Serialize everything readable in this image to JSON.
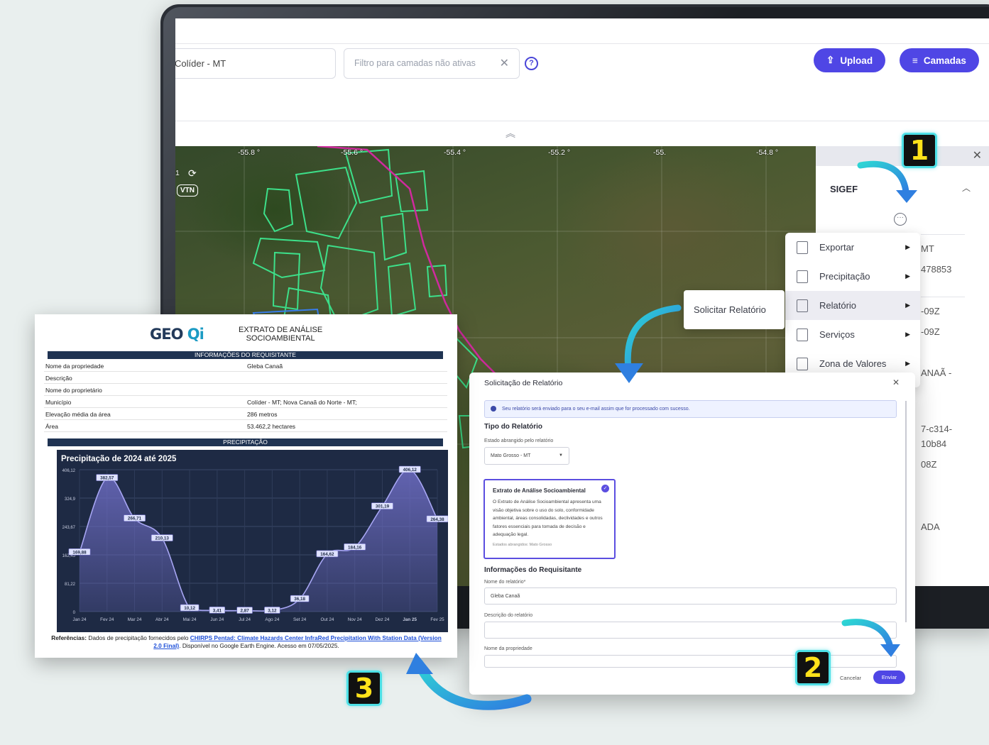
{
  "toolbar": {
    "search_value": "Colíder - MT",
    "filter_placeholder": "Filtro para camadas não ativas",
    "upload_label": "Upload",
    "layers_label": "Camadas"
  },
  "map": {
    "coords": [
      "-55.8 °",
      "-55.6 °",
      "-55.4 °",
      "-55.2 °",
      "-55.",
      "-54.8 °"
    ],
    "vtn_label": "VTN",
    "layer_index": "1"
  },
  "side_panel": {
    "section_title": "SIGEF",
    "values": [
      "MT",
      "478853",
      "-09Z",
      "-09Z",
      "ANAÃ -",
      "7-c314-",
      "10b84",
      "08Z",
      "ADA"
    ]
  },
  "context_menu": {
    "items": [
      {
        "label": "Exportar",
        "icon": "export-icon"
      },
      {
        "label": "Precipitação",
        "icon": "chart-icon"
      },
      {
        "label": "Relatório",
        "icon": "document-icon"
      },
      {
        "label": "Serviços",
        "icon": "document-icon"
      },
      {
        "label": "Zona de Valores",
        "icon": "table-icon"
      }
    ],
    "submenu_label": "Solicitar Relatório"
  },
  "modal": {
    "title": "Solicitação de Relatório",
    "info_text": "Seu relatório será enviado para o seu e-mail assim que for processado com sucesso.",
    "section_type": "Tipo do Relatório",
    "state_label": "Estado abrangido pelo relatório",
    "state_value": "Mato Grosso - MT",
    "card_title": "Extrato de Análise Socioambiental",
    "card_desc": "O Extrato de Análise Socioambiental apresenta uma visão objetiva sobre o uso do solo, conformidade ambiental, áreas consolidadas, declividades e outros fatores essenciais para tomada de decisão e adequação legal.",
    "card_states": "Estados abrangidos: Mato Grosso",
    "section_requester": "Informações do Requisitante",
    "name_label": "Nome do relatório*",
    "name_value": "Gleba Canaã",
    "desc_label": "Descrição do relatório",
    "property_label": "Nome da propriedade",
    "cancel_label": "Cancelar",
    "send_label": "Enviar"
  },
  "report": {
    "logo_left": "GEO",
    "logo_right": "Qi",
    "title_line1": "EXTRATO DE ANÁLISE",
    "title_line2": "SOCIOAMBIENTAL",
    "band_requester": "INFORMAÇÕES DO REQUISITANTE",
    "rows": [
      {
        "key": "Nome da propriedade",
        "value": "Gleba Canaã"
      },
      {
        "key": "Descrição",
        "value": ""
      },
      {
        "key": "Nome do proprietário",
        "value": ""
      },
      {
        "key": "Município",
        "value": "Colíder - MT; Nova Canaã do Norte - MT;"
      },
      {
        "key": "Elevação média da área",
        "value": "286 metros"
      },
      {
        "key": "Área",
        "value": "53.462,2 hectares"
      }
    ],
    "band_precip": "PRECIPITAÇÃO",
    "refs_label": "Referências:",
    "refs_text1": "Dados de precipitação fornecidos pelo",
    "refs_link": "CHIRPS Pentad: Climate Hazards Center InfraRed Precipitation With Station Data (Version 2.0 Final)",
    "refs_text2": ". Disponível no Google Earth Engine. Acesso em 07/05/2025."
  },
  "chart_data": {
    "type": "area",
    "title": "Precipitação de 2024 até 2025",
    "categories": [
      "Jan 24",
      "Fev 24",
      "Mar 24",
      "Abr 24",
      "Mai 24",
      "Jun 24",
      "Jul 24",
      "Ago 24",
      "Set 24",
      "Out 24",
      "Nov 24",
      "Dez 24",
      "Jan 25",
      "Fev 25"
    ],
    "values": [
      169.88,
      382.57,
      266.71,
      210.13,
      10.12,
      3.41,
      2.87,
      3.12,
      36.18,
      164.62,
      184.16,
      301.19,
      406.12,
      264.38
    ],
    "value_labels": [
      "169,88",
      "382,57",
      "266,71",
      "210,13",
      "10,12",
      "3,41",
      "2,87",
      "3,12",
      "36,18",
      "164,62",
      "184,16",
      "301,19",
      "406,12",
      "264,38"
    ],
    "y_ticks": [
      "0",
      "81,22",
      "162,45",
      "243,67",
      "324,9",
      "406,12"
    ],
    "ylim": [
      0,
      406.12
    ],
    "grid": true,
    "colors": {
      "line": "#a7a6f3",
      "fill": "#6e6dc4",
      "bg": "#1e2a44"
    }
  },
  "callouts": [
    "1",
    "2",
    "3"
  ]
}
